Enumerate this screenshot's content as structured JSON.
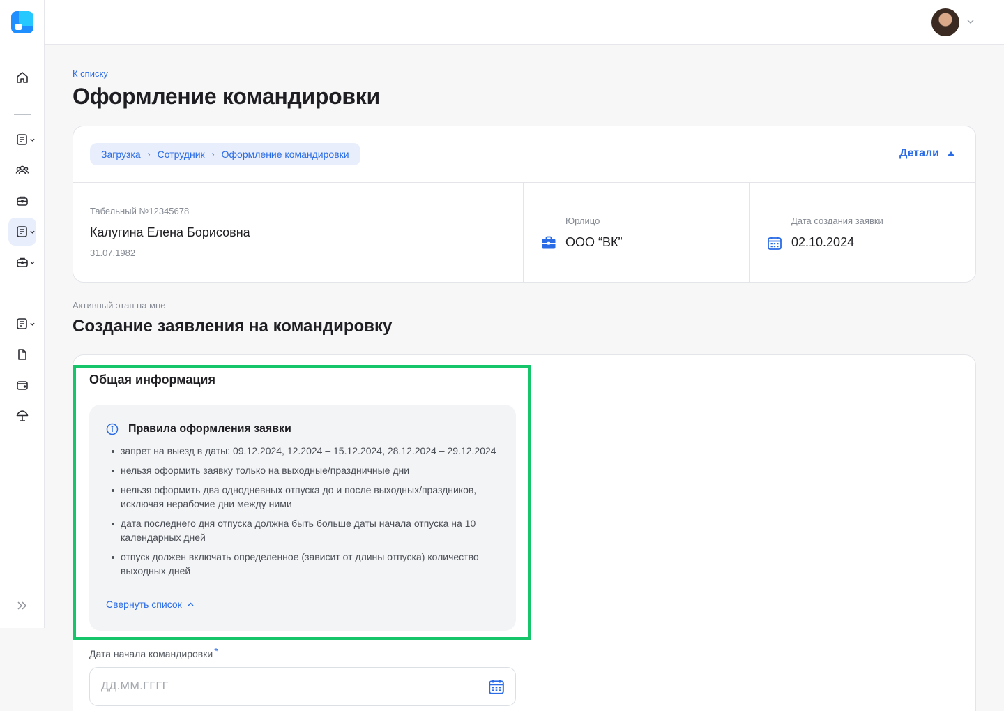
{
  "colors": {
    "accent": "#2a6be6",
    "highlight": "#16c46a",
    "background": "#f7f7f8"
  },
  "sidebar": {
    "items": [
      {
        "icon": "home-icon"
      },
      {
        "icon": "document-icon"
      },
      {
        "icon": "users-icon"
      },
      {
        "icon": "briefcase-icon"
      },
      {
        "icon": "document-icon"
      },
      {
        "icon": "briefcase-icon"
      },
      {
        "icon": "document-icon"
      },
      {
        "icon": "file-icon"
      },
      {
        "icon": "wallet-icon"
      },
      {
        "icon": "umbrella-icon"
      },
      {
        "icon": "expand-icon"
      }
    ]
  },
  "header": {
    "back_link": "К списку",
    "title": "Оформление командировки"
  },
  "card": {
    "breadcrumbs": [
      "Загрузка",
      "Сотрудник",
      "Оформление командировки"
    ],
    "details_label": "Детали",
    "employee": {
      "number": "Табельный №12345678",
      "name": "Калугина Елена Борисовна",
      "dob": "31.07.1982"
    },
    "legal": {
      "label": "Юрлицо",
      "value": "ООО “ВК”"
    },
    "created": {
      "label": "Дата создания заявки",
      "value": "02.10.2024"
    }
  },
  "stage": {
    "label": "Активный этап на мне",
    "title": "Создание заявления на командировку"
  },
  "form": {
    "section_title": "Общая информация",
    "rules": {
      "title": "Правила оформления заявки",
      "items": [
        "запрет на выезд в даты: 09.12.2024, 12.2024 – 15.12.2024, 28.12.2024 – 29.12.2024",
        "нельзя оформить заявку только на выходные/праздничные дни",
        "нельзя оформить два однодневных отпуска до и после выходных/праздников, исключая нерабочие дни между ними",
        "дата последнего дня отпуска должна быть больше даты начала отпуска на 10 календарных дней",
        "отпуск должен включать определенное (зависит от длины отпуска) количество выходных дней"
      ],
      "collapse_label": "Свернуть список"
    },
    "start_date": {
      "label": "Дата начала командировки",
      "required_mark": "*",
      "value": "",
      "placeholder": "ДД.ММ.ГГГГ"
    }
  }
}
